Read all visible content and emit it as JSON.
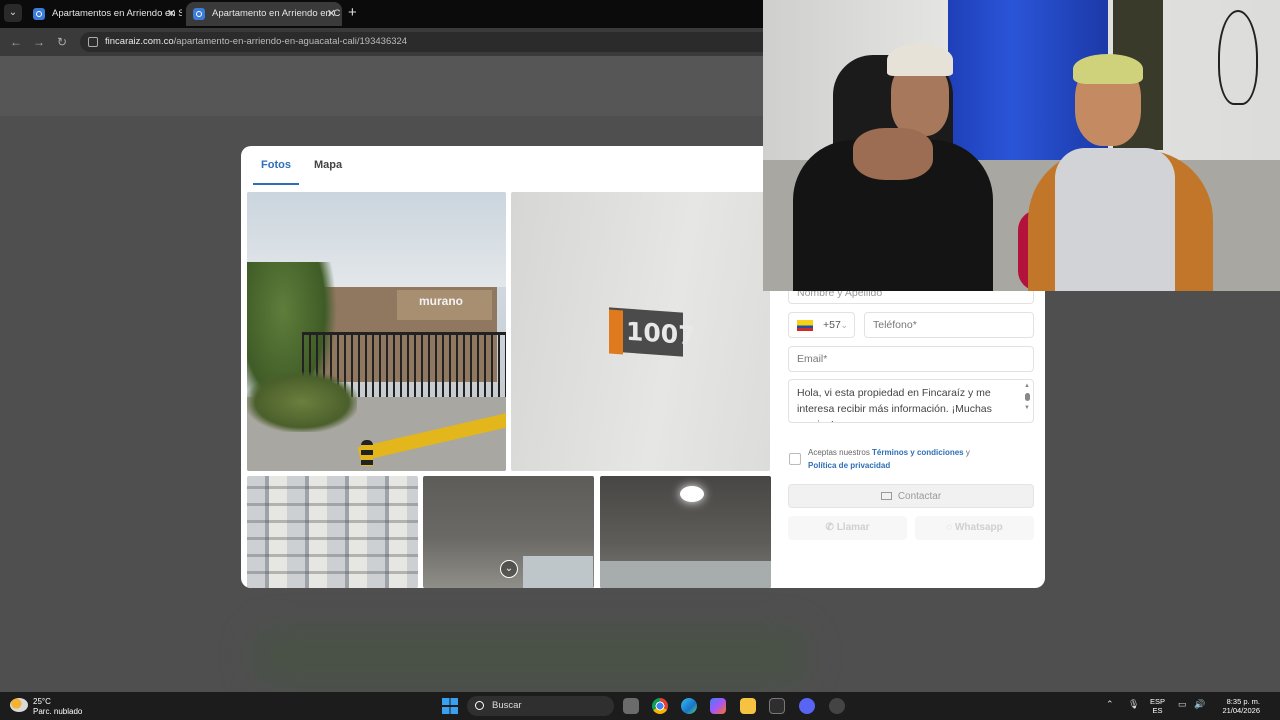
{
  "browser": {
    "tabs": [
      {
        "title": "Apartamentos en Arriendo en S",
        "active": false
      },
      {
        "title": "Apartamento en Arriendo en C",
        "active": true
      }
    ],
    "url_host": "fincaraiz.com.co",
    "url_path": "/apartamento-en-arriendo-en-aguacatal-cali/193436324"
  },
  "modal": {
    "tabs": [
      {
        "label": "Fotos",
        "active": true
      },
      {
        "label": "Mapa",
        "active": false
      }
    ],
    "photos": {
      "building_sign": "murano",
      "door_number": "1007"
    }
  },
  "contact_form": {
    "name_placeholder": "Nombre y Apellido",
    "country_code": "+57",
    "phone_placeholder": "Teléfono*",
    "email_placeholder": "Email*",
    "message": "Hola, vi esta propiedad en Fincaraíz y me interesa recibir más información. ¡Muchas gracias!",
    "terms_prefix": "Aceptas nuestros",
    "terms_link": "Términos y condiciones",
    "terms_and": "y",
    "privacy_link": "Política de privacidad",
    "contact_button": "Contactar",
    "call_button": "Llamar",
    "whatsapp_button": "Whatsapp"
  },
  "taskbar": {
    "weather_temp": "25°C",
    "weather_desc": "Parc. nublado",
    "search_placeholder": "Buscar",
    "lang_line1": "ESP",
    "lang_line2": "ES",
    "time": "8:35 p. m.",
    "date": "21/04/2026"
  },
  "colors": {
    "accent": "#2f6fb5",
    "taskbar": "#1c1c1c"
  }
}
